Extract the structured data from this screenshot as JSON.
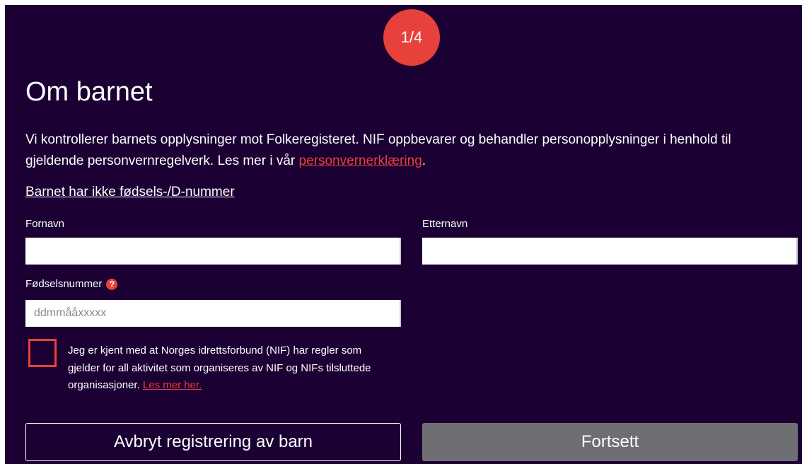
{
  "step": {
    "indicator": "1/4"
  },
  "page": {
    "title": "Om barnet",
    "intro_text": "Vi kontrollerer barnets opplysninger mot Folkeregisteret. NIF oppbevarer og behandler personopplysninger i henhold til gjeldende personvernregelverk. Les mer i vår ",
    "privacy_link": "personvernerklæring",
    "intro_end": "."
  },
  "no_id_link": "Barnet har ikke fødsels-/D-nummer",
  "form": {
    "first_name": {
      "label": "Fornavn",
      "value": ""
    },
    "last_name": {
      "label": "Etternavn",
      "value": ""
    },
    "ssn": {
      "label": "Fødselsnummer",
      "placeholder": "ddmmååxxxxx",
      "value": "",
      "help_icon": "?"
    },
    "consent": {
      "checked": false,
      "text": "Jeg er kjent med at Norges idrettsforbund (NIF) har regler som gjelder for all aktivitet som organiseres av NIF og NIFs tilsluttede organisasjoner. ",
      "link": "Les mer her."
    }
  },
  "buttons": {
    "cancel": "Avbryt registrering av barn",
    "continue": "Fortsett"
  },
  "colors": {
    "background": "#1a0033",
    "accent": "#e8403a",
    "disabled_button": "#6f6f73",
    "text": "#ffffff"
  },
  "icons": {
    "help": "question-circle-icon",
    "checkbox": "checkbox-unchecked"
  }
}
